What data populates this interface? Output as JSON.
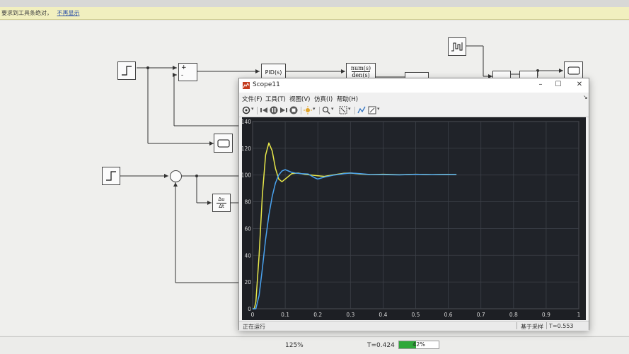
{
  "notification": {
    "text": "要求到工具条绝对，",
    "link": "不再显示"
  },
  "model": {
    "pid_label": "PID(s)",
    "tf_num": "num(s)",
    "tf_den": "den(s)",
    "sum_plus": "+",
    "sum_minus": "-",
    "deriv_num": "Δu",
    "deriv_den": "Δt"
  },
  "status": {
    "zoom": "125%",
    "time": "T=0.424",
    "progress_text": "42%",
    "progress_fraction": 0.42
  },
  "scope": {
    "title": "Scope11",
    "menu": [
      "文件(F)",
      "工具(T)",
      "视图(V)",
      "仿真(I)",
      "帮助(H)"
    ],
    "status_left": "正在运行",
    "status_mode": "基于采样",
    "status_time": "T=0.553"
  },
  "icons": [
    "scope-app-icon",
    "minimize-icon",
    "maximize-icon",
    "close-icon",
    "settings-icon",
    "step-back-icon",
    "pause-icon",
    "step-forward-icon",
    "stop-icon",
    "highlight-icon",
    "zoom-icon",
    "autoscale-icon",
    "cursor-measure-icon",
    "properties-icon",
    "undock-icon"
  ],
  "colors": {
    "plot_bg": "#1d1f24",
    "series_yellow": "#e8e84a",
    "series_blue": "#4aa3f0",
    "notification_bg": "#f1efbf",
    "progress_green": "#2fa83a"
  },
  "chart_data": {
    "type": "line",
    "title": "",
    "xlabel": "",
    "ylabel": "",
    "xlim": [
      0,
      1
    ],
    "ylim": [
      0,
      140
    ],
    "xticks": [
      "0",
      "0.1",
      "0.2",
      "0.3",
      "0.4",
      "0.5",
      "0.6",
      "0.7",
      "0.8",
      "0.9",
      "1"
    ],
    "yticks": [
      "0",
      "20",
      "40",
      "60",
      "80",
      "100",
      "120",
      "140"
    ],
    "grid": true,
    "series": [
      {
        "color": "#e8e84a",
        "x": [
          0,
          0.005,
          0.01,
          0.02,
          0.03,
          0.04,
          0.05,
          0.06,
          0.07,
          0.08,
          0.09,
          0.1,
          0.12,
          0.14,
          0.16,
          0.18,
          0.2,
          0.22,
          0.25,
          0.28,
          0.3,
          0.33,
          0.36,
          0.4,
          0.45,
          0.5,
          0.55,
          0.6,
          0.625
        ],
        "y": [
          0,
          0,
          5,
          40,
          85,
          115,
          124,
          118,
          105,
          97,
          95,
          97,
          101,
          101.5,
          100.5,
          100,
          99.5,
          99,
          100.2,
          101.3,
          101.5,
          100.8,
          100.3,
          100.6,
          100.2,
          100.6,
          100.3,
          100.5,
          100.4
        ]
      },
      {
        "color": "#4aa3f0",
        "x": [
          0,
          0.01,
          0.02,
          0.03,
          0.04,
          0.05,
          0.06,
          0.07,
          0.08,
          0.09,
          0.1,
          0.11,
          0.12,
          0.13,
          0.15,
          0.17,
          0.19,
          0.2,
          0.22,
          0.25,
          0.28,
          0.3,
          0.33,
          0.36,
          0.4,
          0.45,
          0.5,
          0.55,
          0.6,
          0.625
        ],
        "y": [
          0,
          0,
          10,
          30,
          52,
          70,
          84,
          94,
          100,
          103,
          104,
          103,
          102,
          101.5,
          101,
          100.8,
          98,
          97,
          98.5,
          100,
          101,
          101.5,
          101,
          100.4,
          100.3,
          100.1,
          100.5,
          100.2,
          100.4,
          100.4
        ]
      }
    ]
  }
}
